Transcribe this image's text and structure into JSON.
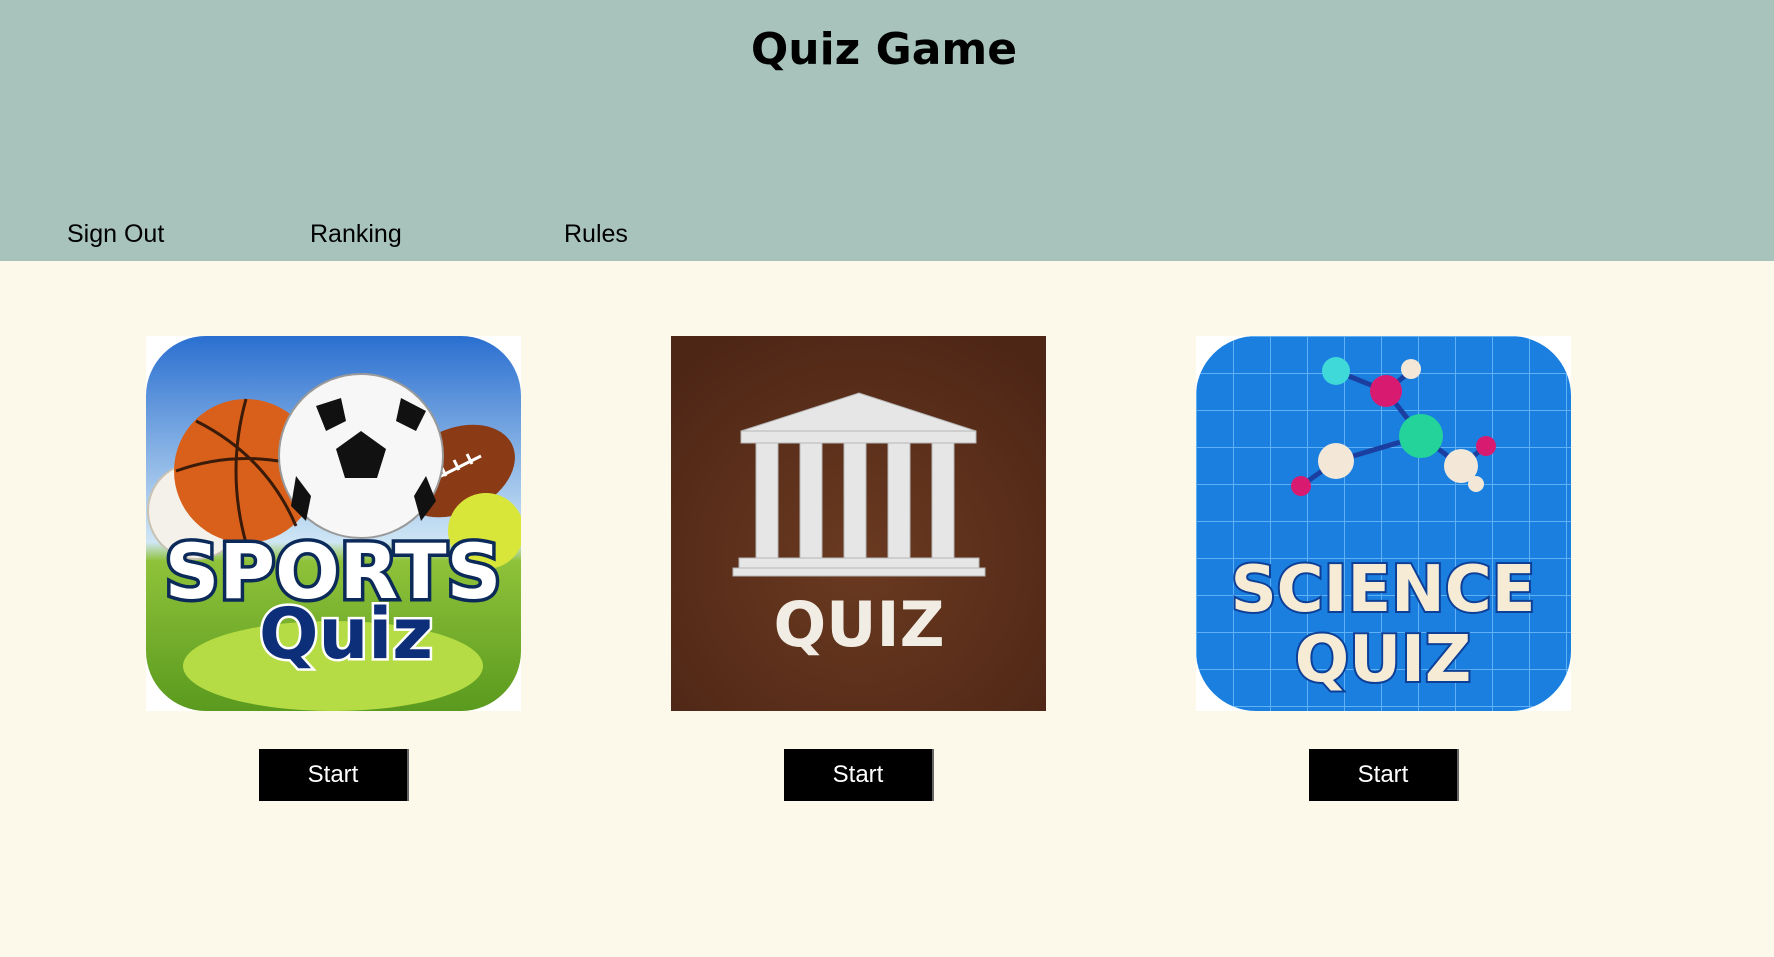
{
  "header": {
    "title": "Quiz Game",
    "nav": [
      {
        "label": "Sign Out"
      },
      {
        "label": "Ranking"
      },
      {
        "label": "Rules"
      }
    ]
  },
  "quizzes": [
    {
      "image_text_top": "SPORTS",
      "image_text_bottom": "Quiz",
      "button_label": "Start"
    },
    {
      "image_text": "QUIZ",
      "button_label": "Start"
    },
    {
      "image_text_top": "SCIENCE",
      "image_text_bottom": "QUIZ",
      "button_label": "Start"
    }
  ],
  "colors": {
    "header_bg": "#a8c3bb",
    "page_bg": "#fdf9ea",
    "button_bg": "#000000",
    "history_bg": "#5a2d18",
    "science_bg": "#1b7fe0"
  }
}
